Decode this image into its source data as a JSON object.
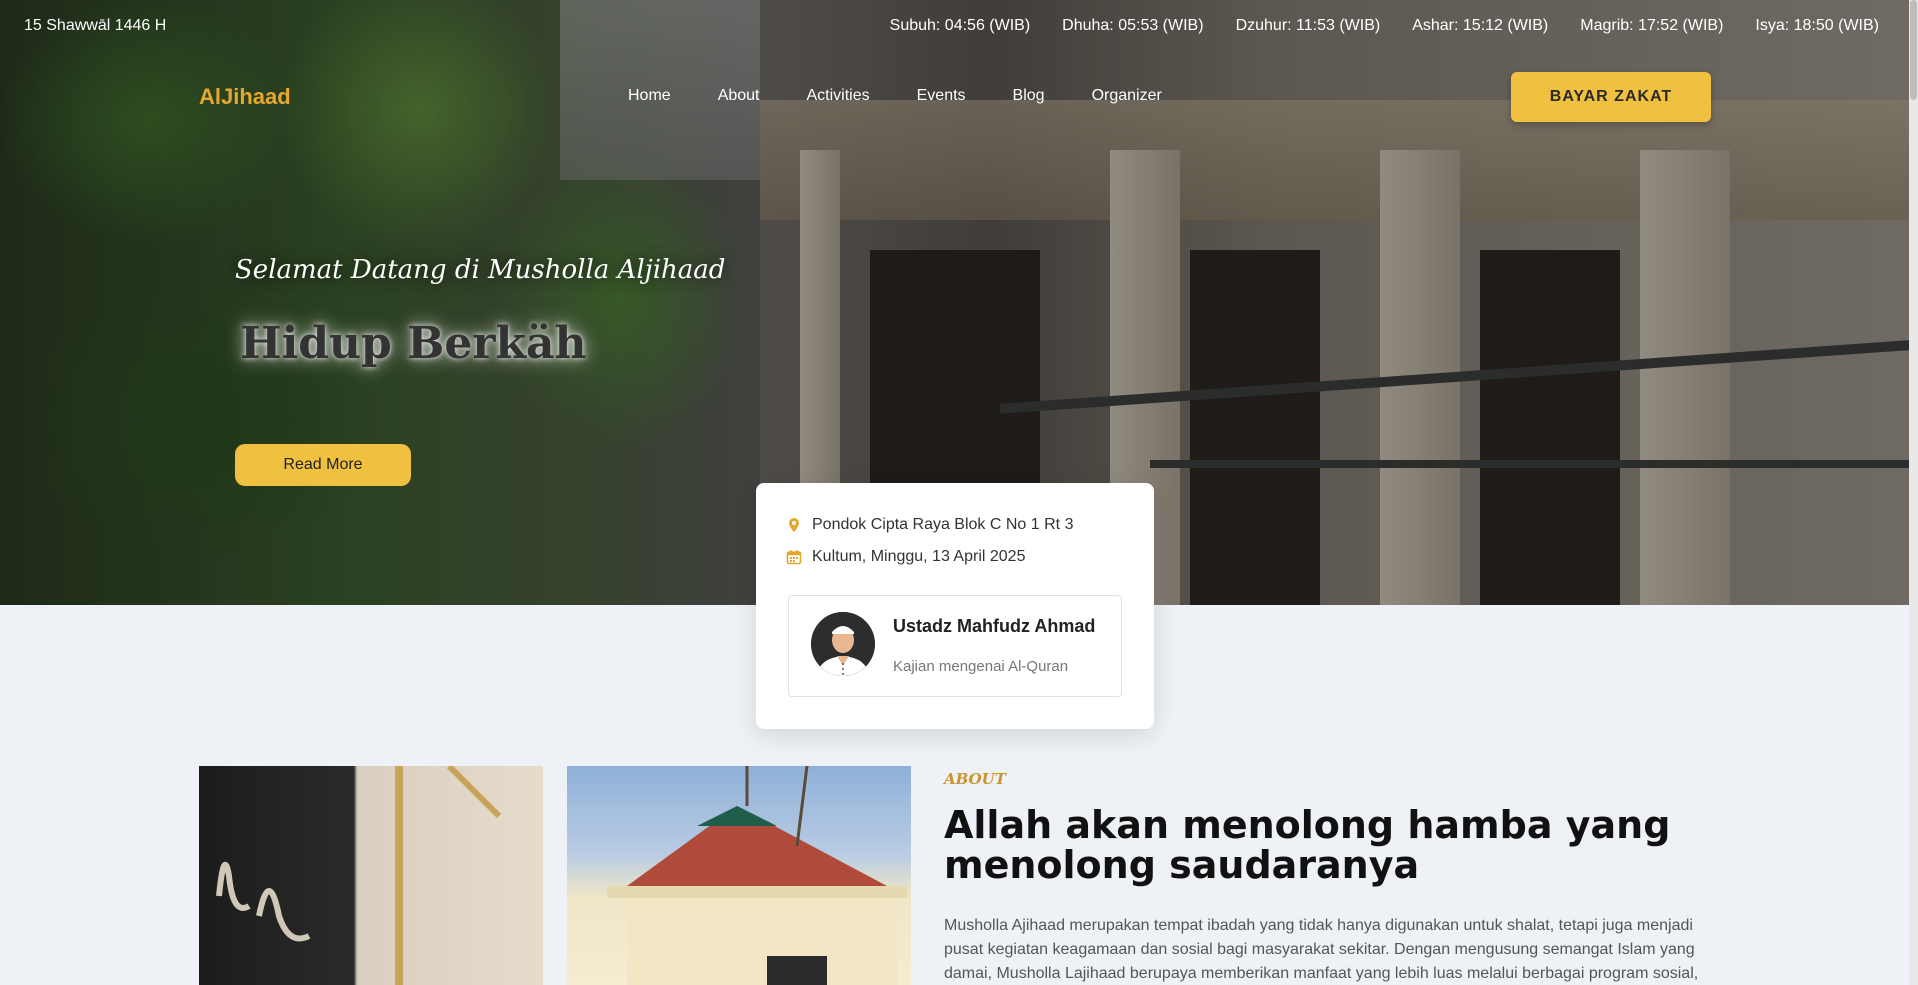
{
  "topbar": {
    "hijri_date": "15 Shawwāl 1446 H",
    "prayers": [
      "Subuh: 04:56 (WIB)",
      "Dhuha: 05:53 (WIB)",
      "Dzuhur: 11:53 (WIB)",
      "Ashar: 15:12 (WIB)",
      "Magrib: 17:52 (WIB)",
      "Isya: 18:50 (WIB)"
    ]
  },
  "navbar": {
    "logo": "AlJihaad",
    "links": [
      "Home",
      "About",
      "Activities",
      "Events",
      "Blog",
      "Organizer"
    ],
    "cta": "BAYAR ZAKAT"
  },
  "hero": {
    "welcome": "Selamat Datang di Musholla Aljihaad",
    "tagline": "Hidup Berkäh",
    "read_more": "Read More"
  },
  "event": {
    "location": "Pondok Cipta Raya Blok C No 1 Rt 3",
    "schedule": "Kultum, Minggu, 13 April 2025",
    "speaker_name": "Ustadz Mahfudz Ahmad",
    "speaker_topic": "Kajian mengenai Al-Quran"
  },
  "about": {
    "label": "ABOUT",
    "title": "Allah akan menolong hamba yang menolong saudaranya",
    "text": "Musholla Ajihaad merupakan tempat ibadah yang tidak hanya digunakan untuk shalat, tetapi juga menjadi pusat kegiatan keagamaan dan sosial bagi masyarakat sekitar. Dengan mengusung semangat Islam yang damai, Musholla Lajihaad berupaya memberikan manfaat yang lebih luas melalui berbagai program sosial,"
  },
  "colors": {
    "accent": "#f0c040",
    "logo": "#e5a72e",
    "about_label": "#c8952a",
    "page_bg": "#eef1f5"
  }
}
